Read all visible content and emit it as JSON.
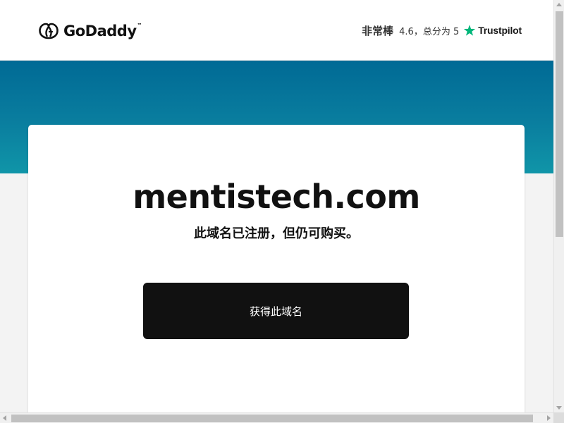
{
  "header": {
    "brand": "GoDaddy",
    "brand_mark": "™",
    "rating": {
      "word": "非常棒",
      "score_text": "4.6，总分为 5",
      "provider": "Trustpilot",
      "star_color": "#00b67a"
    }
  },
  "hero": {
    "band_colors": [
      "#006a95",
      "#1095a8"
    ]
  },
  "main": {
    "domain": "mentistech.com",
    "status": "此域名已注册，但仍可购买。",
    "cta_label": "获得此域名"
  },
  "icons": {
    "logo": "godaddy-logo-icon",
    "trustpilot": "trustpilot-star-icon"
  }
}
